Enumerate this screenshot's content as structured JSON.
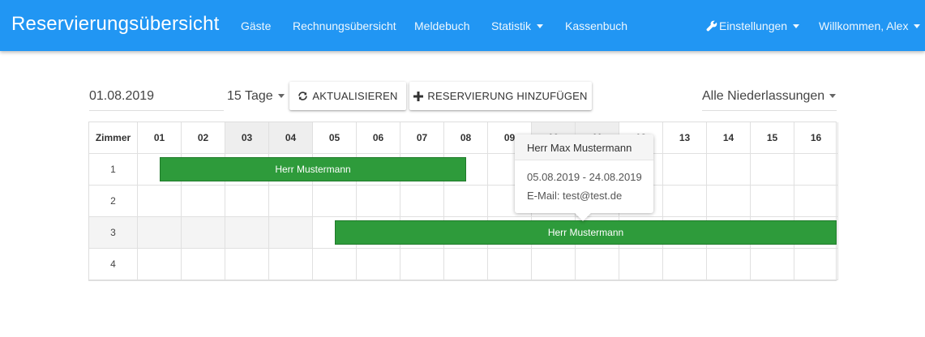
{
  "navbar": {
    "brand": "Reservierungsübersicht",
    "items": [
      {
        "label": "Gäste"
      },
      {
        "label": "Rechnungsübersicht"
      },
      {
        "label": "Meldebuch"
      },
      {
        "label": "Statistik"
      },
      {
        "label": "Kassenbuch"
      }
    ],
    "settings_label": "Einstellungen",
    "user_label": "Willkommen, Alex",
    "color": "#2196f3"
  },
  "controls": {
    "date": "01.08.2019",
    "days": "15 Tage",
    "refresh_label": "AKTUALISIEREN",
    "add_label": "RESERVIERUNG HINZUFÜGEN",
    "branch": "Alle Niederlassungen"
  },
  "grid": {
    "room_header": "Zimmer",
    "days": [
      "01",
      "02",
      "03",
      "04",
      "05",
      "06",
      "07",
      "08",
      "09",
      "10",
      "11",
      "12",
      "13",
      "14",
      "15",
      "16"
    ],
    "weekend_days": [
      "03",
      "04",
      "10",
      "11"
    ],
    "rooms": [
      "1",
      "2",
      "3",
      "4"
    ],
    "bookings": [
      {
        "room": "1",
        "label": "Herr Mustermann",
        "from_day": 1.5,
        "to_day": 8.5
      },
      {
        "room": "3",
        "label": "Herr Mustermann",
        "from_day": 5.5,
        "to_day": 17
      }
    ],
    "booking_color": "#2e9b3b"
  },
  "tooltip": {
    "title": "Herr Max Mustermann",
    "dates": "05.08.2019 - 24.08.2019",
    "email": "E-Mail: test@test.de"
  }
}
